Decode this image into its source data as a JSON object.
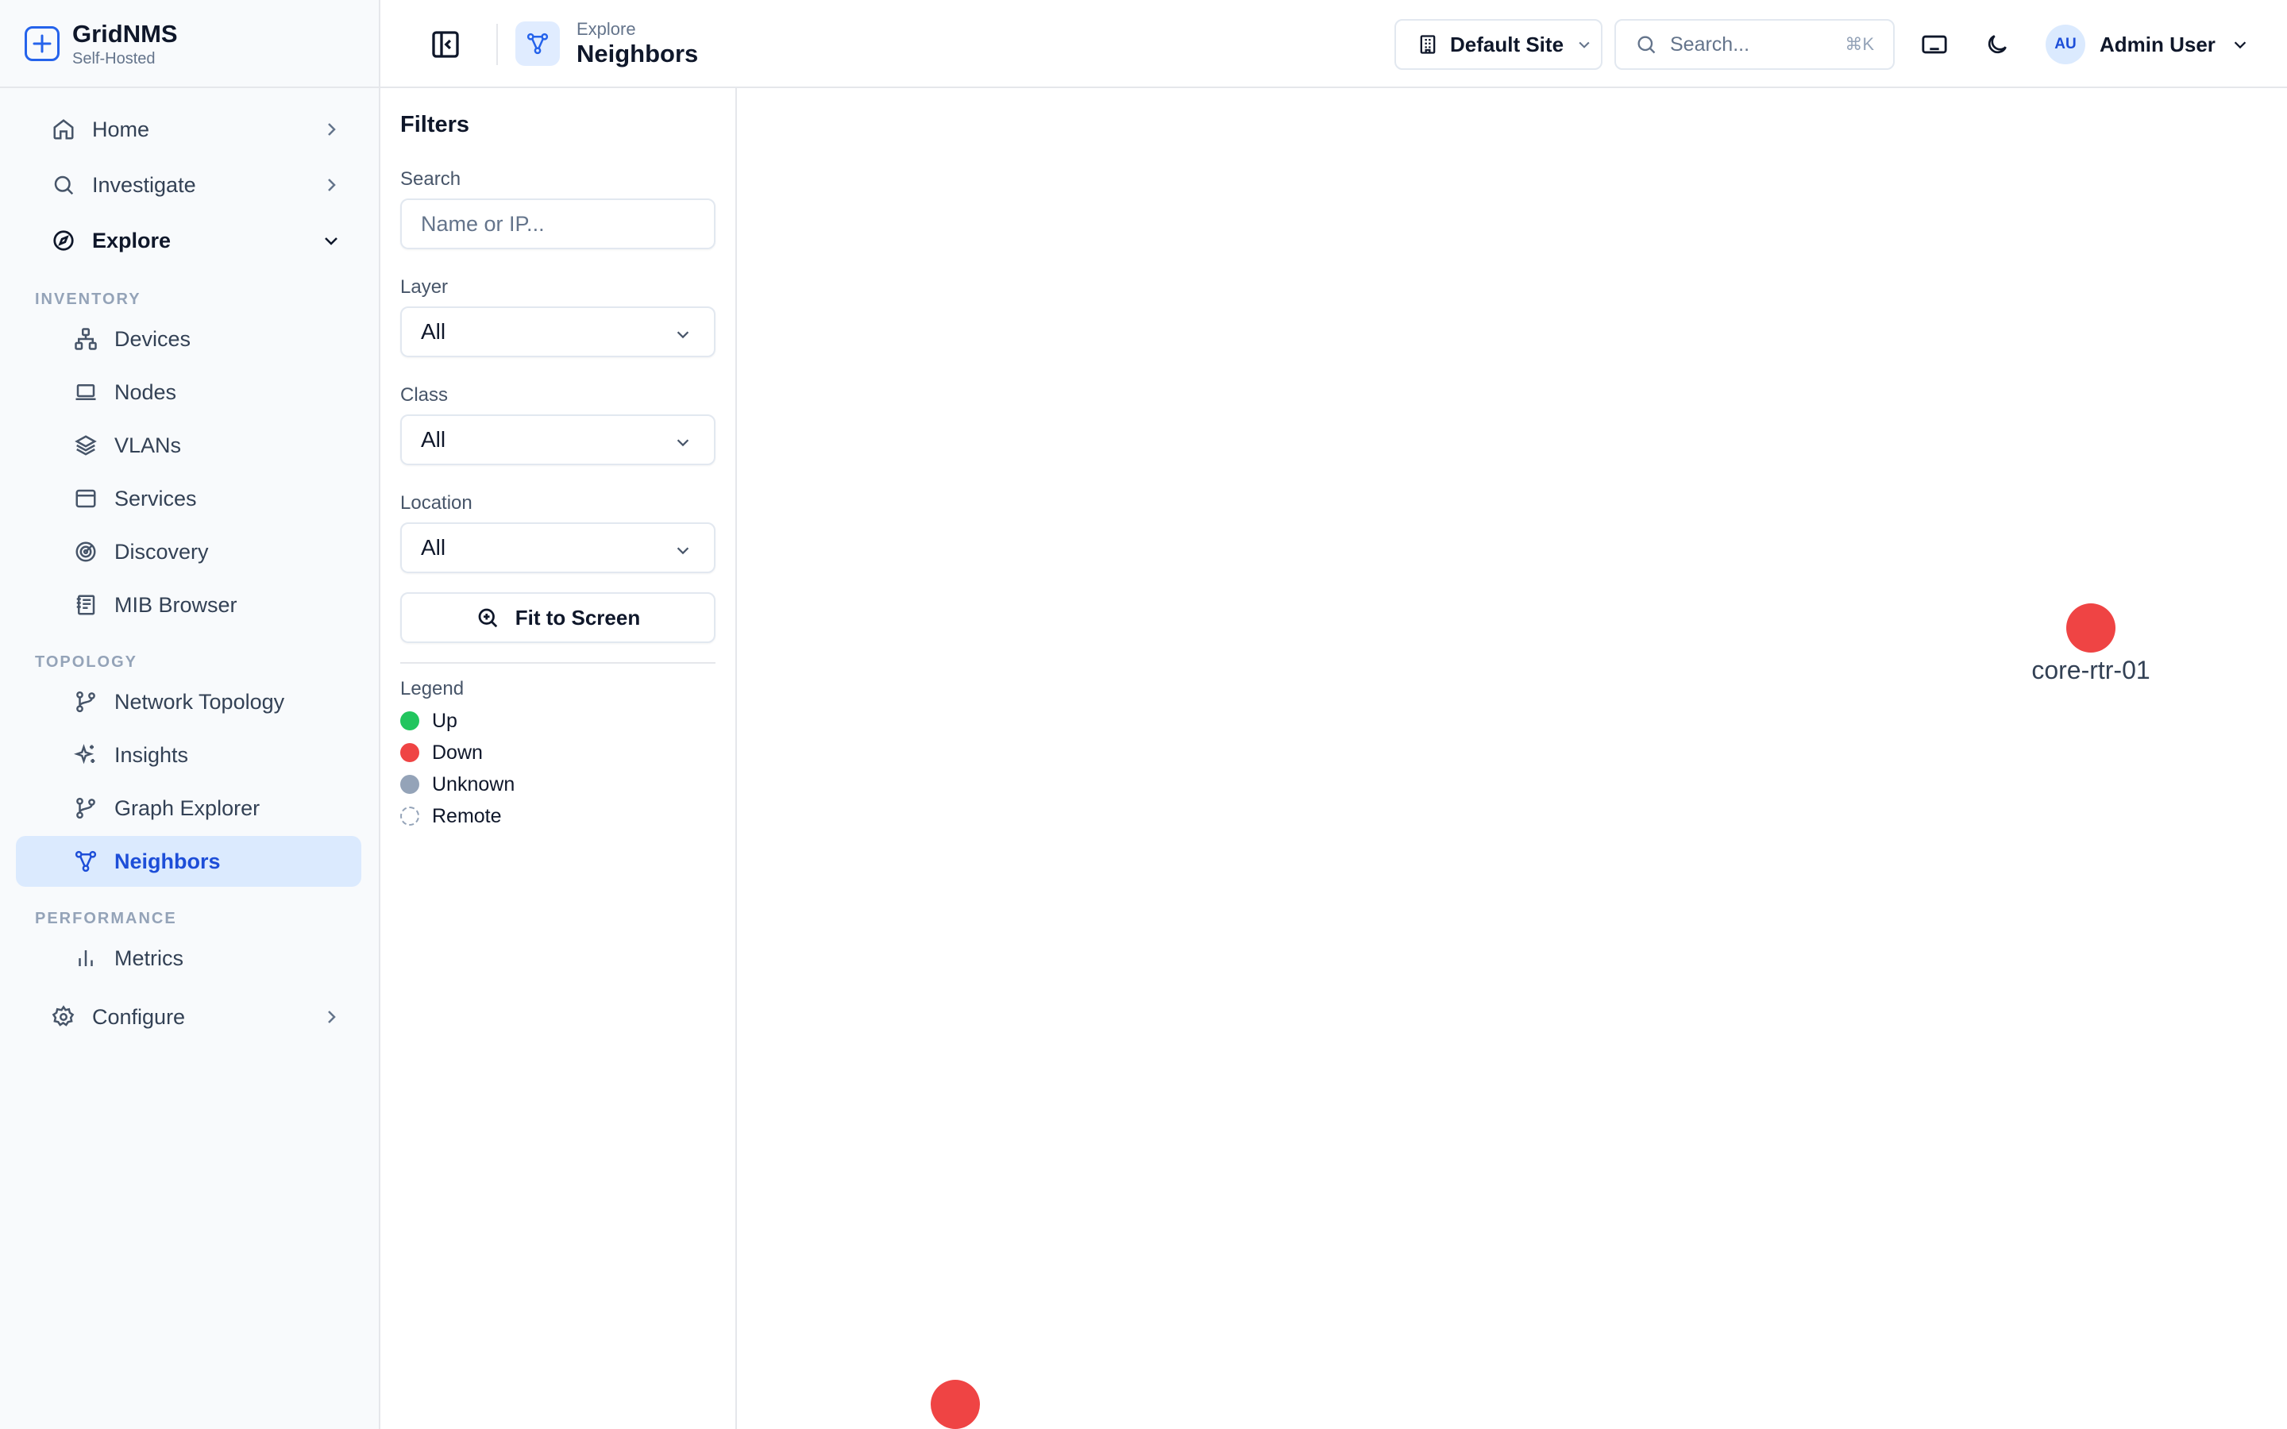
{
  "app": {
    "name": "GridNMS",
    "subtitle": "Self-Hosted"
  },
  "sidebar": {
    "home": "Home",
    "investigate": "Investigate",
    "explore": "Explore",
    "configure": "Configure",
    "sections": {
      "inventory": {
        "label": "INVENTORY",
        "items": [
          {
            "label": "Devices",
            "icon": "sitemap-icon"
          },
          {
            "label": "Nodes",
            "icon": "laptop-icon"
          },
          {
            "label": "VLANs",
            "icon": "layers-icon"
          },
          {
            "label": "Services",
            "icon": "window-icon"
          },
          {
            "label": "Discovery",
            "icon": "radar-icon"
          },
          {
            "label": "MIB Browser",
            "icon": "book-icon"
          }
        ]
      },
      "topology": {
        "label": "TOPOLOGY",
        "items": [
          {
            "label": "Network Topology",
            "icon": "git-branch-icon"
          },
          {
            "label": "Insights",
            "icon": "sparkles-icon"
          },
          {
            "label": "Graph Explorer",
            "icon": "git-branch-icon"
          },
          {
            "label": "Neighbors",
            "icon": "network-icon",
            "active": true
          }
        ]
      },
      "performance": {
        "label": "PERFORMANCE",
        "items": [
          {
            "label": "Metrics",
            "icon": "bar-chart-icon"
          }
        ]
      }
    }
  },
  "header": {
    "breadcrumb_parent": "Explore",
    "title": "Neighbors",
    "site": "Default Site",
    "search_placeholder": "Search...",
    "search_shortcut": "⌘K",
    "user_initials": "AU",
    "user_name": "Admin User"
  },
  "filters": {
    "title": "Filters",
    "search_label": "Search",
    "search_placeholder": "Name or IP...",
    "layer_label": "Layer",
    "layer_value": "All",
    "class_label": "Class",
    "class_value": "All",
    "location_label": "Location",
    "location_value": "All",
    "fit_button": "Fit to Screen",
    "legend_title": "Legend",
    "legend": [
      {
        "label": "Up",
        "color": "#22c55e"
      },
      {
        "label": "Down",
        "color": "#ef4444"
      },
      {
        "label": "Unknown",
        "color": "#94a3b8"
      },
      {
        "label": "Remote",
        "color": "dashed"
      }
    ]
  },
  "graph": {
    "nodes": [
      {
        "label": "core-rtr-01",
        "status": "down"
      },
      {
        "label": "",
        "status": "down"
      }
    ]
  }
}
